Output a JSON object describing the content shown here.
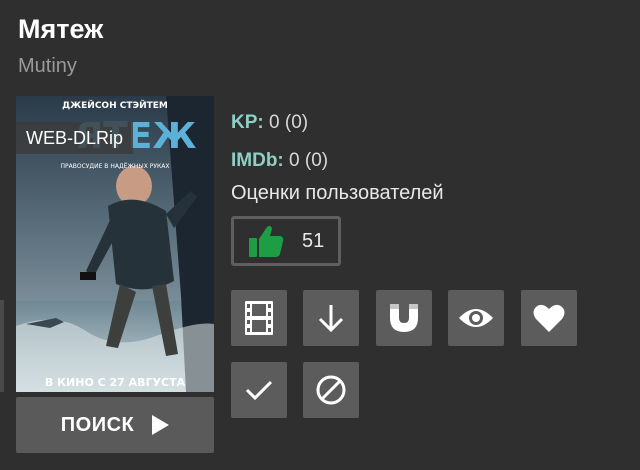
{
  "movie": {
    "title": "Мятеж",
    "original_title": "Mutiny",
    "quality": "WEB-DLRip"
  },
  "ratings": {
    "kp_label": "KP:",
    "kp_value": "0 (0)",
    "imdb_label": "IMDb:",
    "imdb_value": "0 (0)",
    "user_ratings_label": "Оценки пользователей",
    "likes": "51"
  },
  "search": {
    "label": "ПОИСК"
  },
  "actions": [
    {
      "icon": "film-icon"
    },
    {
      "icon": "download-arrow-icon"
    },
    {
      "icon": "magnet-icon"
    },
    {
      "icon": "eye-icon"
    },
    {
      "icon": "heart-icon"
    },
    {
      "icon": "checkmark-icon"
    },
    {
      "icon": "block-icon"
    }
  ],
  "poster": {
    "actor_text": "ДЖЕЙСОН СТЭЙТЕМ",
    "tagline": "ПРАВОСУДИЕ В НАДЁЖНЫХ РУКАХ",
    "release_text": "В КИНО С 27 АВГУСТА"
  },
  "colors": {
    "background": "#2f2f2f",
    "accent_teal": "#8fcfc6",
    "like_green": "#1e9e44",
    "button_gray": "#5c5c5c"
  }
}
